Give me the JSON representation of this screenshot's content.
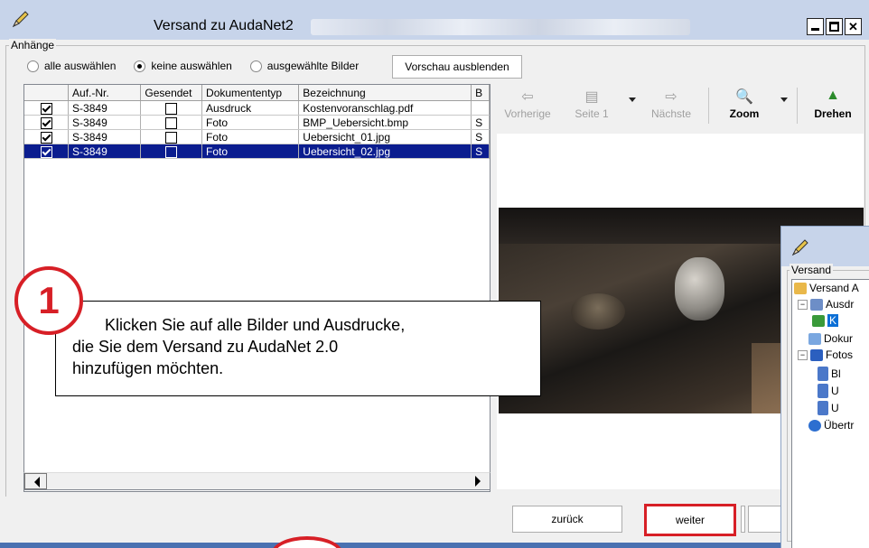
{
  "window": {
    "title": "Versand zu AudaNet2",
    "controls": [
      "minimize",
      "maximize",
      "close"
    ]
  },
  "attachments": {
    "group_label": "Anhänge",
    "radios": [
      {
        "label": "alle auswählen",
        "checked": false
      },
      {
        "label": "keine auswählen",
        "checked": true
      },
      {
        "label": "ausgewählte Bilder",
        "checked": false
      }
    ],
    "preview_button": "Vorschau ausblenden"
  },
  "table": {
    "columns": [
      "",
      "Auf.-Nr.",
      "Gesendet",
      "Dokumententyp",
      "Bezeichnung",
      "B"
    ],
    "rows": [
      {
        "checked": true,
        "order": "S-3849",
        "sent": false,
        "type": "Ausdruck",
        "name": "Kostenvoranschlag.pdf",
        "extra": "",
        "selected": false
      },
      {
        "checked": true,
        "order": "S-3849",
        "sent": false,
        "type": "Foto",
        "name": "BMP_Uebersicht.bmp",
        "extra": "S",
        "selected": false
      },
      {
        "checked": true,
        "order": "S-3849",
        "sent": false,
        "type": "Foto",
        "name": "Uebersicht_01.jpg",
        "extra": "S",
        "selected": false
      },
      {
        "checked": true,
        "order": "S-3849",
        "sent": false,
        "type": "Foto",
        "name": "Uebersicht_02.jpg",
        "extra": "S",
        "selected": true
      }
    ]
  },
  "viewer_toolbar": {
    "previous": "Vorherige",
    "page": "Seite 1",
    "next": "Nächste",
    "zoom": "Zoom",
    "rotate": "Drehen"
  },
  "callout": {
    "number": "1",
    "text_line1": "Klicken Sie auf alle Bilder und Ausdrucke,",
    "text_line2": "die Sie dem Versand zu AudaNet 2.0",
    "text_line3": "hinzufügen möchten."
  },
  "buttons": {
    "back": "zurück",
    "next": "weiter"
  },
  "side_dialog": {
    "group_label": "Versand",
    "tree": [
      {
        "label": "Versand A",
        "level": 0
      },
      {
        "label": "Ausdr",
        "level": 1
      },
      {
        "label": "K",
        "level": 2
      },
      {
        "label": "Dokur",
        "level": 1
      },
      {
        "label": "Fotos",
        "level": 1
      },
      {
        "label": "Bl",
        "level": 2
      },
      {
        "label": "U",
        "level": 2
      },
      {
        "label": "U",
        "level": 2
      },
      {
        "label": "Übertr",
        "level": 1
      }
    ]
  },
  "colors": {
    "highlight_red": "#d71f26",
    "selection_blue": "#0b1d8f",
    "titlebar": "#c7d4ea"
  }
}
